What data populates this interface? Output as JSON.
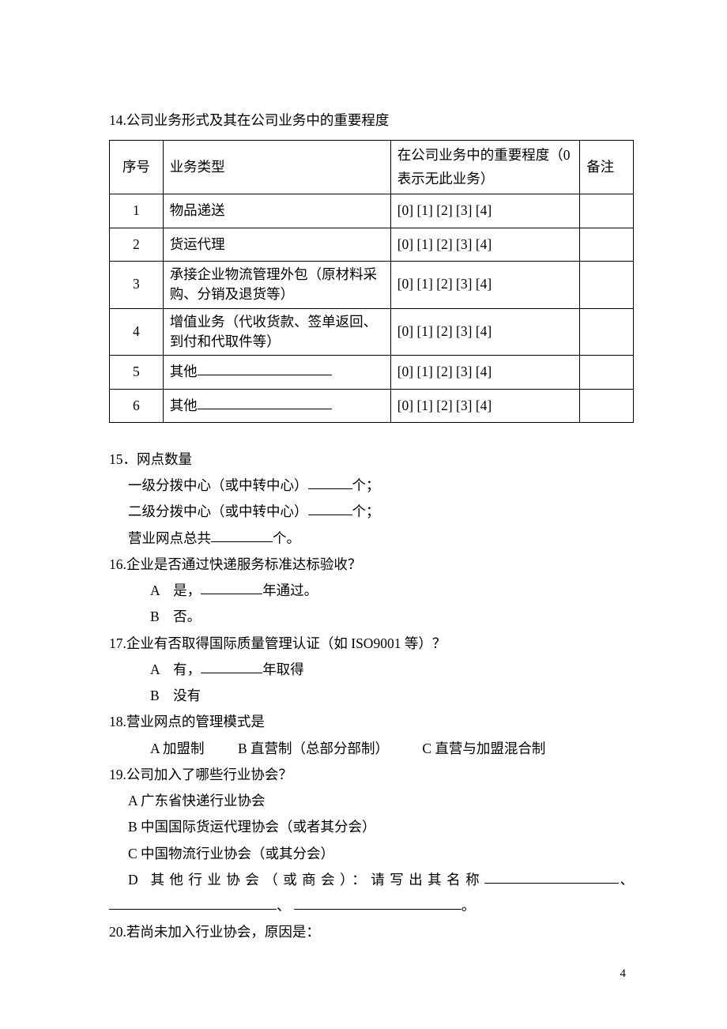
{
  "q14": {
    "title": "14.公司业务形式及其在公司业务中的重要程度",
    "headers": {
      "seq": "序号",
      "type": "业务类型",
      "importance": "在公司业务中的重要程度（0 表示无此业务）",
      "note": "备注"
    },
    "scale": "[0] [1] [2] [3] [4]",
    "rows": [
      {
        "n": "1",
        "type": "物品递送"
      },
      {
        "n": "2",
        "type": "货运代理"
      },
      {
        "n": "3",
        "type": "承接企业物流管理外包（原材料采购、分销及退货等）"
      },
      {
        "n": "4",
        "type": "增值业务（代收货款、签单返回、到付和代取件等）"
      },
      {
        "n": "5",
        "type": "其他"
      },
      {
        "n": "6",
        "type": "其他"
      }
    ]
  },
  "q15": {
    "title": "15．网点数量",
    "line1a": "一级分拨中心（或中转中心）",
    "line1b": "个；",
    "line2a": "二级分拨中心（或中转中心）",
    "line2b": "个；",
    "line3a": "营业网点总共",
    "line3b": "个。"
  },
  "q16": {
    "title": "16.企业是否通过快递服务标准达标验收？",
    "optA_pre": "A　是，",
    "optA_post": "年通过。",
    "optB": "B　否。"
  },
  "q17": {
    "title": "17.企业有否取得国际质量管理认证（如 ISO9001 等）？",
    "optA_pre": "A　有，",
    "optA_post": "年取得",
    "optB": "B　没有"
  },
  "q18": {
    "title": "18.营业网点的管理模式是",
    "optA": "A 加盟制",
    "optB": "B 直营制（总部分部制）",
    "optC": "C 直营与加盟混合制"
  },
  "q19": {
    "title": "19.公司加入了哪些行业协会？",
    "optA": "A 广东省快递行业协会",
    "optB": "B 中国国际货运代理协会（或者其分会）",
    "optC": "C 中国物流行业协会（或其分会）",
    "optD_pre": "D 其他行业协会（或商会）：请写出其名称",
    "sep1": "、",
    "sep2": "、",
    "end": "。"
  },
  "q20": {
    "title": "20.若尚未加入行业协会，原因是："
  },
  "page_number": "4"
}
